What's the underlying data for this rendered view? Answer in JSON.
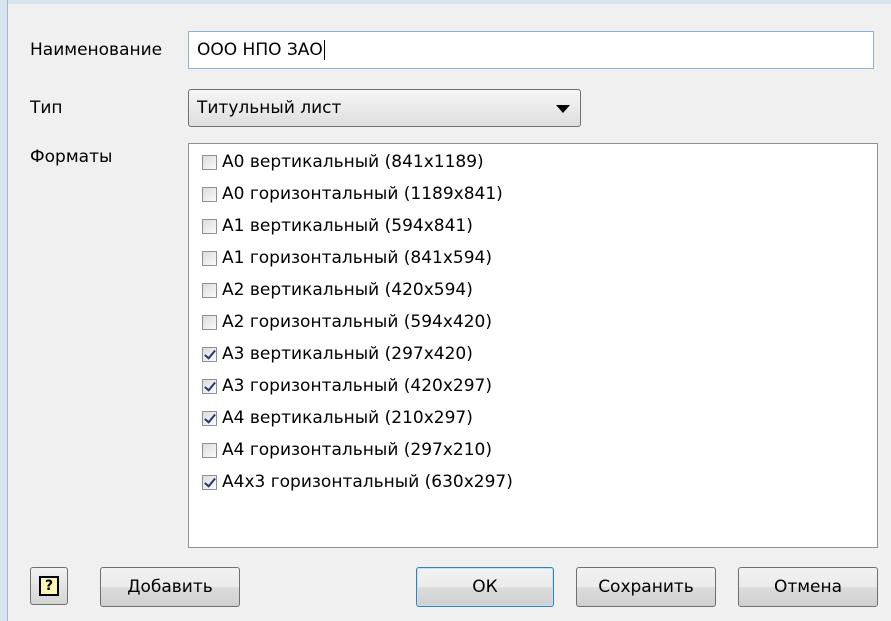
{
  "form": {
    "name_label": "Наименование",
    "name_value": "ООО НПО ЗАО",
    "type_label": "Тип",
    "type_value": "Титульный лист",
    "formats_label": "Форматы"
  },
  "formats": [
    {
      "label": "А0 вертикальный (841х1189)",
      "checked": false
    },
    {
      "label": "А0 горизонтальный (1189х841)",
      "checked": false
    },
    {
      "label": "А1 вертикальный (594х841)",
      "checked": false
    },
    {
      "label": "А1 горизонтальный (841х594)",
      "checked": false
    },
    {
      "label": "А2 вертикальный (420х594)",
      "checked": false
    },
    {
      "label": "А2 горизонтальный (594х420)",
      "checked": false
    },
    {
      "label": "А3 вертикальный (297х420)",
      "checked": true
    },
    {
      "label": "А3 горизонтальный (420х297)",
      "checked": true
    },
    {
      "label": "А4 вертикальный (210х297)",
      "checked": true
    },
    {
      "label": "А4 горизонтальный (297х210)",
      "checked": false
    },
    {
      "label": "А4х3 горизонтальный (630х297)",
      "checked": true
    }
  ],
  "buttons": {
    "help_icon": "question-mark-icon",
    "add": "Добавить",
    "ok": "ОК",
    "save": "Сохранить",
    "cancel": "Отмена"
  }
}
